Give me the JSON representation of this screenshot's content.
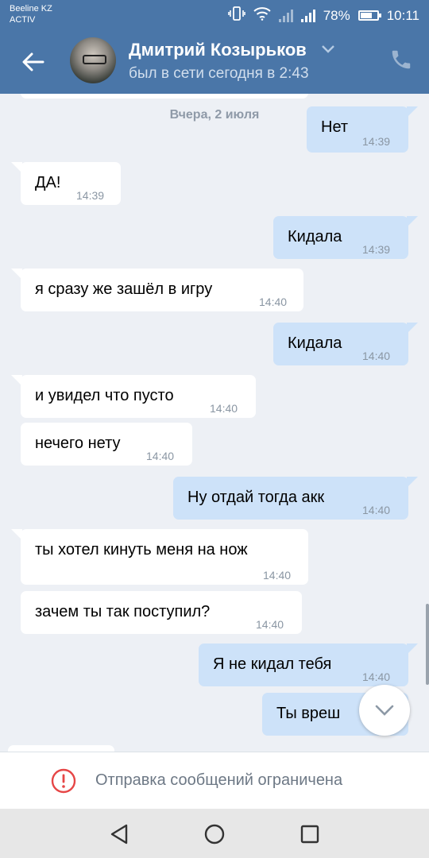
{
  "status_bar": {
    "carrier_line1": "Beeline KZ",
    "carrier_line2": "ACTIV",
    "battery_percent": "78%",
    "battery_level": 0.78,
    "time": "10:11"
  },
  "header": {
    "contact_name": "Дмитрий Козырьков",
    "last_seen": "был в сети сегодня в 2:43",
    "icons": [
      "back-arrow-icon",
      "chevron-down-icon",
      "phone-icon"
    ]
  },
  "chat": {
    "date_separator": "Вчера, 2 июля",
    "messages": [
      {
        "dir": "out",
        "text": "Нет",
        "time": "14:39"
      },
      {
        "dir": "in",
        "text": "ДА!",
        "time": "14:39"
      },
      {
        "dir": "out",
        "text": "Кидала",
        "time": "14:39"
      },
      {
        "dir": "in",
        "text": "я сразу же зашёл в игру",
        "time": "14:40"
      },
      {
        "dir": "out",
        "text": "Кидала",
        "time": "14:40"
      },
      {
        "dir": "in",
        "text": "и увидел что пусто",
        "time": "14:40"
      },
      {
        "dir": "in",
        "text": "нечего нету",
        "time": "14:40"
      },
      {
        "dir": "out",
        "text": "Ну отдай тогда акк",
        "time": "14:40"
      },
      {
        "dir": "in",
        "text": "ты хотел кинуть меня на нож",
        "time": "14:40"
      },
      {
        "dir": "in",
        "text": "зачем ты так поступил?",
        "time": "14:40"
      },
      {
        "dir": "out",
        "text": "Я не кидал тебя",
        "time": "14:40"
      },
      {
        "dir": "out",
        "text": "Ты вреш",
        "time": ""
      }
    ]
  },
  "restriction": {
    "text": "Отправка сообщений ограничена",
    "icon": "exclamation-circle-icon",
    "color": "#e64646"
  },
  "colors": {
    "header": "#4a76a8",
    "background": "#edf0f5",
    "incoming": "#ffffff",
    "outgoing": "#cde2f9"
  }
}
